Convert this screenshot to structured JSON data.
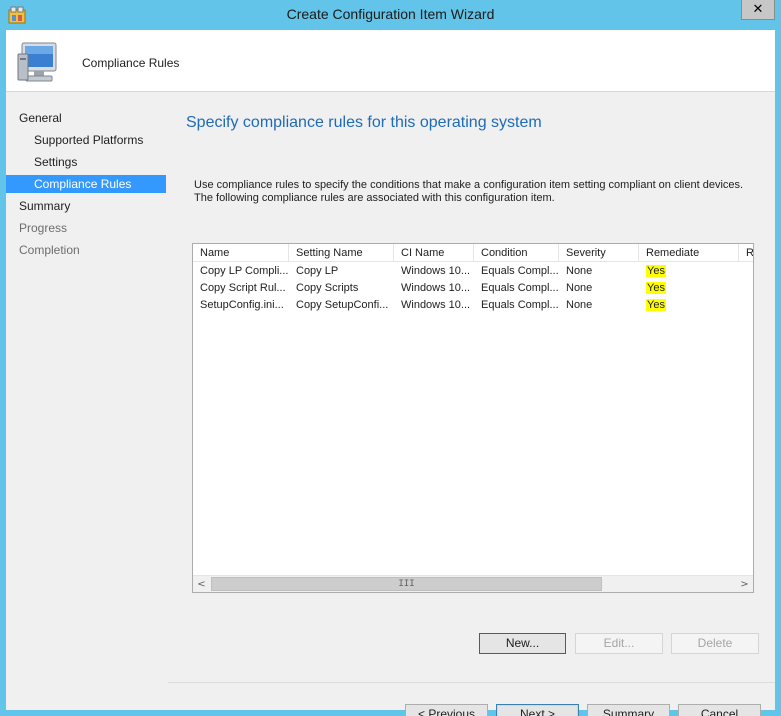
{
  "window": {
    "title": "Create Configuration Item Wizard",
    "close_glyph": "✕"
  },
  "header": {
    "title": "Compliance Rules",
    "icon": "computer-monitor-icon"
  },
  "nav": {
    "items": [
      {
        "label": "General"
      },
      {
        "label": "Supported Platforms"
      },
      {
        "label": "Settings"
      },
      {
        "label": "Compliance Rules"
      },
      {
        "label": "Summary"
      },
      {
        "label": "Progress"
      },
      {
        "label": "Completion"
      }
    ],
    "selected": "Compliance Rules"
  },
  "main": {
    "heading": "Specify compliance rules for this operating system",
    "description": "Use compliance rules to specify the conditions that make a configuration item setting compliant on client devices. The following compliance rules are associated with this configuration item."
  },
  "rules_table": {
    "columns": [
      "Name",
      "Setting Name",
      "CI Name",
      "Condition",
      "Severity",
      "Remediate",
      "R"
    ],
    "rows": [
      [
        "Copy LP Compli...",
        "Copy LP",
        "Windows 10...",
        "Equals Compl...",
        "None",
        "Yes"
      ],
      [
        "Copy Script Rul...",
        "Copy Scripts",
        "Windows 10...",
        "Equals Compl...",
        "None",
        "Yes"
      ],
      [
        "SetupConfig.ini...",
        "Copy SetupConfi...",
        "Windows 10...",
        "Equals Compl...",
        "None",
        "Yes"
      ]
    ],
    "scroll_left": "<",
    "scroll_right": ">",
    "scroll_grip": "III"
  },
  "rule_buttons": {
    "new": "New...",
    "edit": "Edit...",
    "delete": "Delete"
  },
  "footer_buttons": {
    "previous": "< Previous",
    "next": "Next >",
    "summary": "Summary",
    "cancel": "Cancel"
  },
  "colors": {
    "title_bar": "#62c4e8",
    "nav_selected": "#3399ff",
    "heading": "#1f6bb4",
    "highlight": "#ffff00"
  }
}
